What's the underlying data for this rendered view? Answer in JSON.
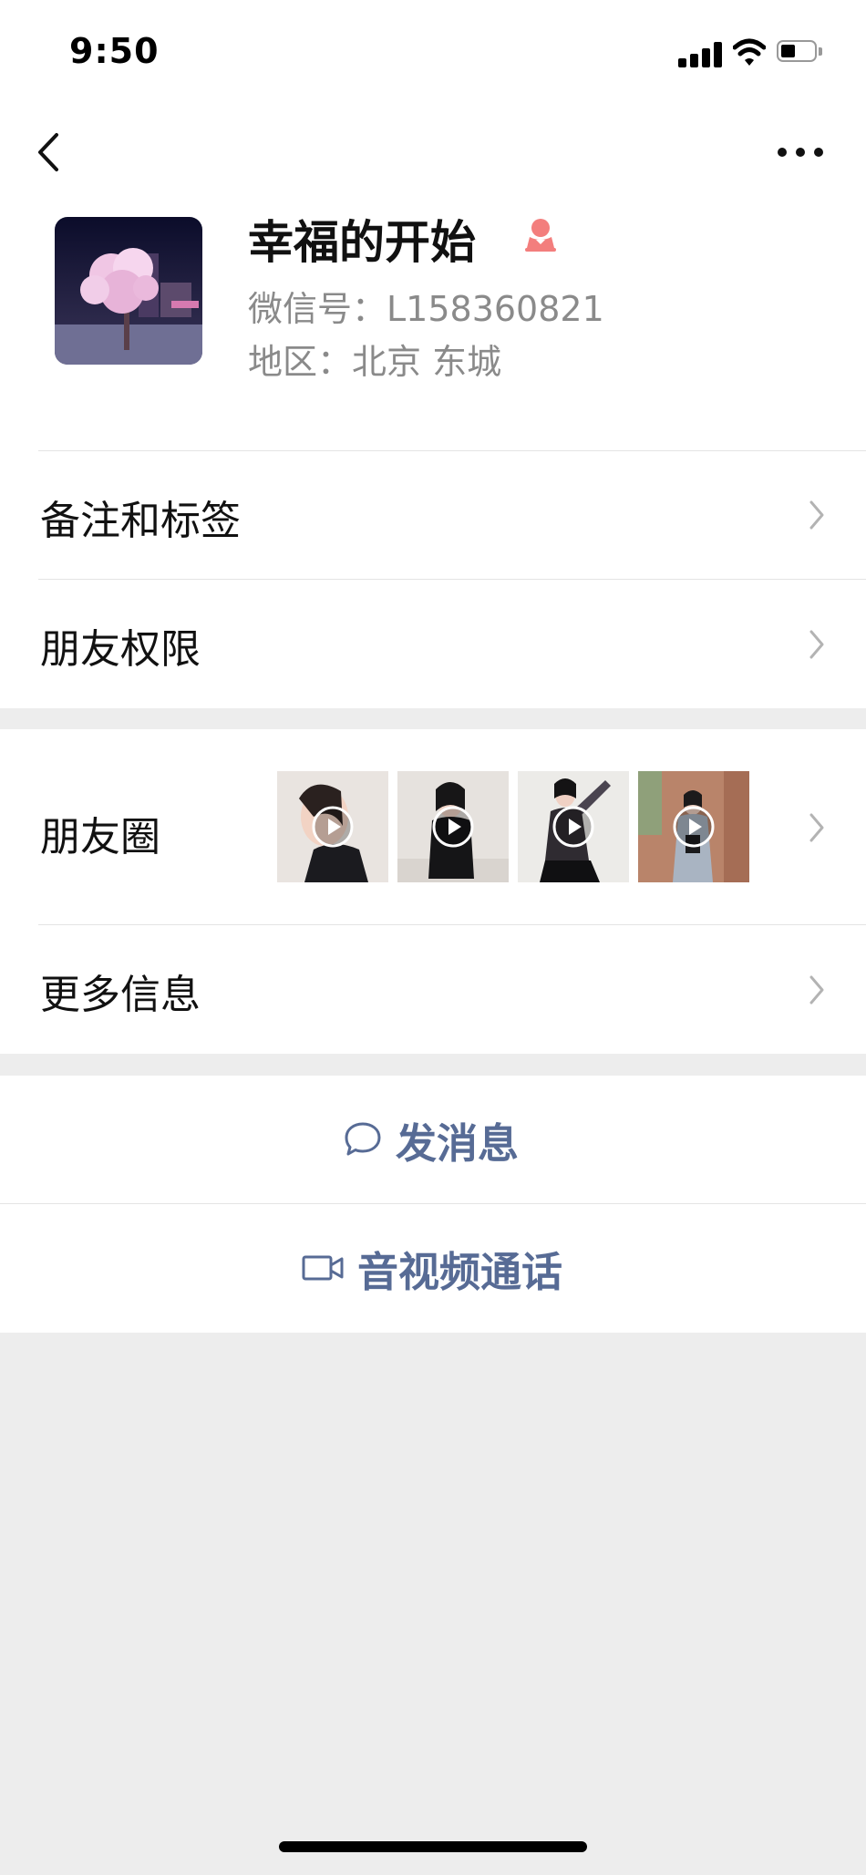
{
  "status_bar": {
    "time": "9:50"
  },
  "profile": {
    "name": "幸福的开始",
    "wechat_id": "微信号：L158360821",
    "region": "地区：北京 东城",
    "gender_icon": "female-icon",
    "gender_color": "#f37e7d"
  },
  "menu": {
    "remark_tags": "备注和标签",
    "friend_permissions": "朋友权限",
    "moments": "朋友圈",
    "more_info": "更多信息"
  },
  "moments_thumbs": [
    "video-thumb",
    "video-thumb",
    "video-thumb",
    "video-thumb"
  ],
  "actions": {
    "send_message": "发消息",
    "av_call": "音视频通话"
  },
  "colors": {
    "link": "#576b95",
    "background": "#ededed",
    "secondary_text": "#8a8a8a"
  }
}
